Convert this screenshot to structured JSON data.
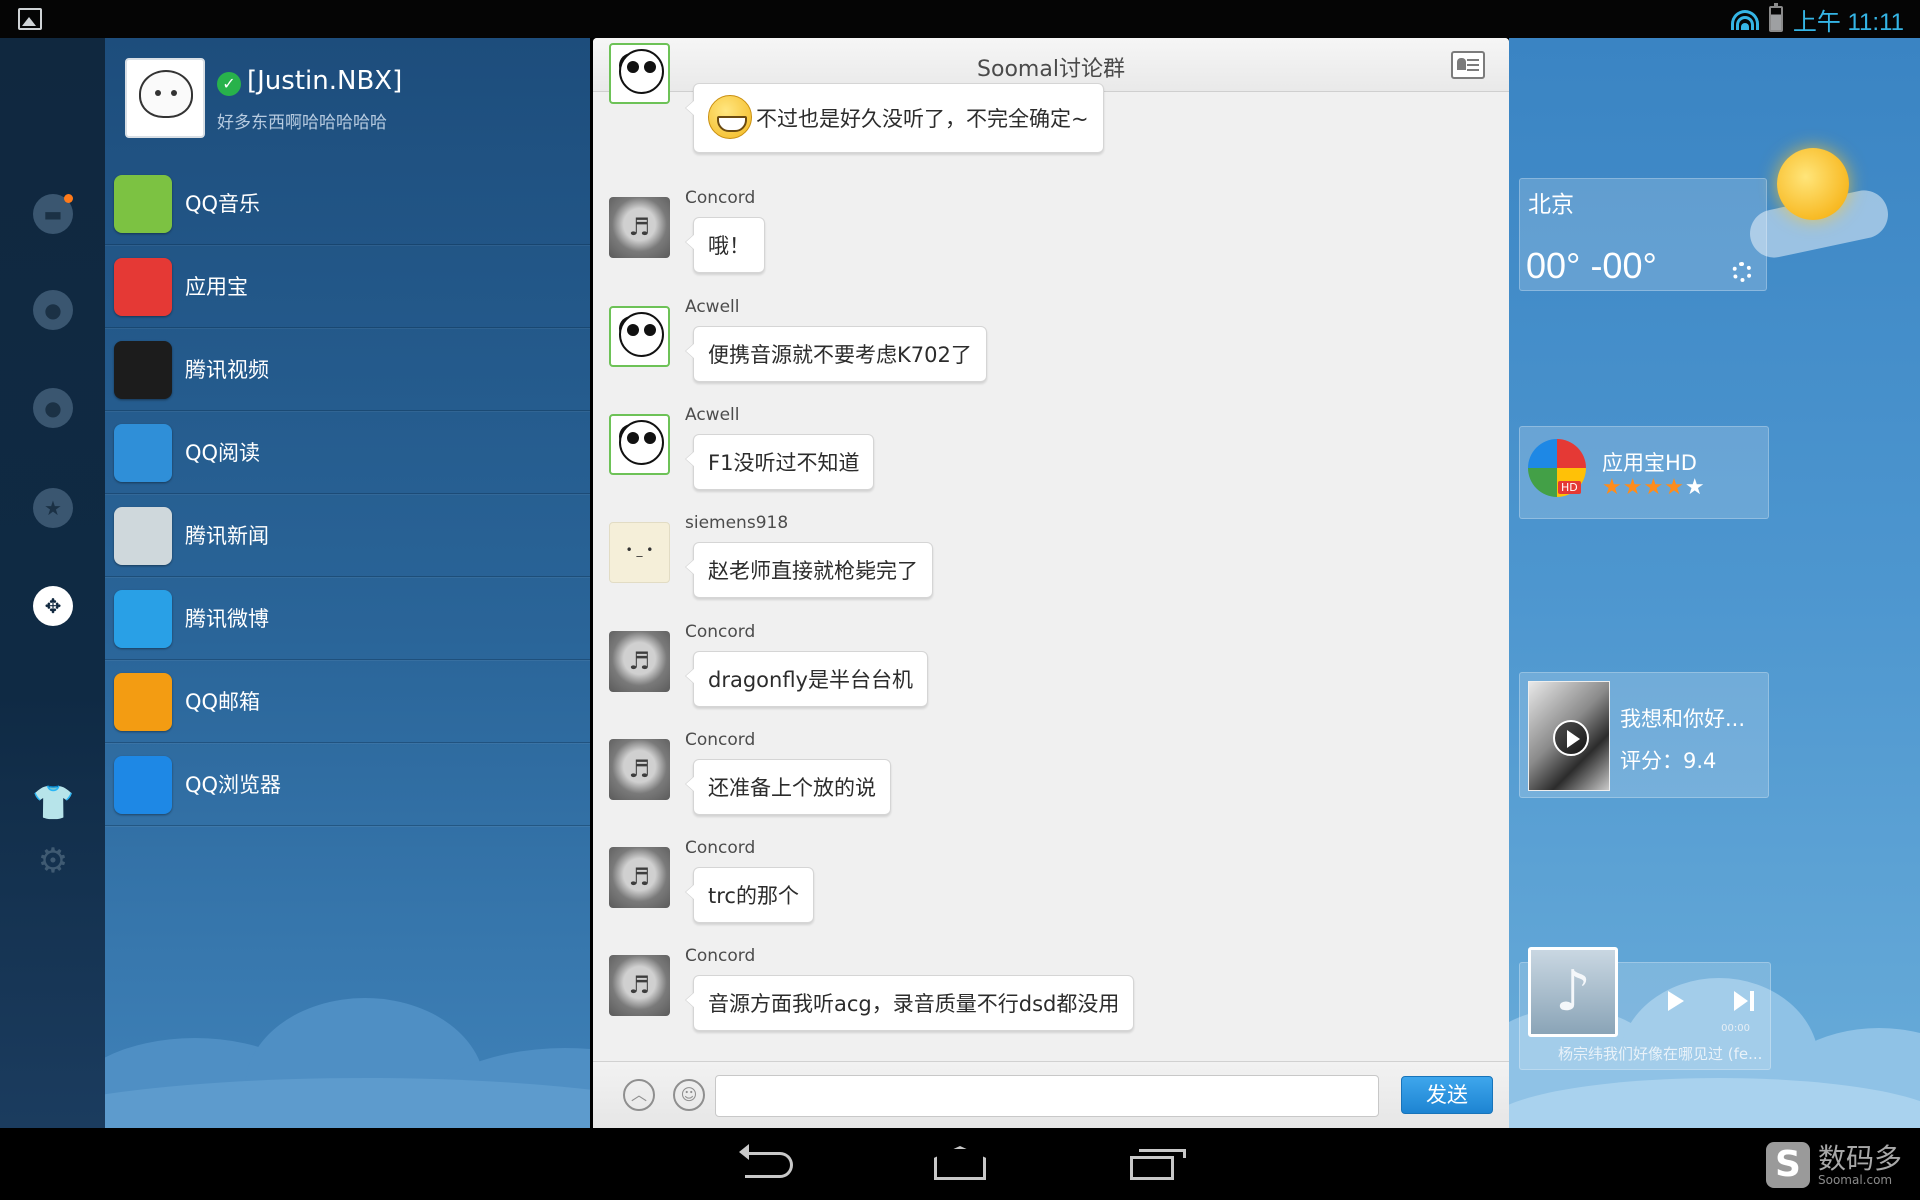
{
  "status_bar": {
    "time": "上午 11:11"
  },
  "profile": {
    "name": "[Justin.NBX]",
    "signature": "好多东西啊哈哈哈哈哈"
  },
  "apps": [
    {
      "label": "QQ音乐",
      "icon": "qq-music-icon",
      "color": "#7cc242"
    },
    {
      "label": "应用宝",
      "icon": "app-store-icon",
      "color": "#e53935"
    },
    {
      "label": "腾讯视频",
      "icon": "tencent-video-icon",
      "color": "#1c1c1c"
    },
    {
      "label": "QQ阅读",
      "icon": "qq-reader-icon",
      "color": "#2f8fd8"
    },
    {
      "label": "腾讯新闻",
      "icon": "tencent-news-icon",
      "color": "#cfd8dc"
    },
    {
      "label": "腾讯微博",
      "icon": "tencent-weibo-icon",
      "color": "#29a0e6"
    },
    {
      "label": "QQ邮箱",
      "icon": "qq-mail-icon",
      "color": "#f39c12"
    },
    {
      "label": "QQ浏览器",
      "icon": "qq-browser-icon",
      "color": "#1e88e5"
    }
  ],
  "chat": {
    "title": "Soomal讨论群",
    "messages": [
      {
        "sender": "",
        "text": "不过也是好久没听了，不完全确定~"
      },
      {
        "sender": "Concord",
        "text": "哦！"
      },
      {
        "sender": "Acwell",
        "text": "便携音源就不要考虑K702了"
      },
      {
        "sender": "Acwell",
        "text": "F1没听过不知道"
      },
      {
        "sender": "siemens918",
        "text": "赵老师直接就枪毙完了"
      },
      {
        "sender": "Concord",
        "text": "dragonfly是半台台机"
      },
      {
        "sender": "Concord",
        "text": "还准备上个放的说"
      },
      {
        "sender": "Concord",
        "text": "trc的那个"
      },
      {
        "sender": "Concord",
        "text": "音源方面我听acg，录音质量不行dsd都没用"
      }
    ],
    "input_value": "",
    "send_label": "发送"
  },
  "weather": {
    "city": "北京",
    "temperature": "00° -00°"
  },
  "app_widget": {
    "name": "应用宝HD",
    "hd_tag": "HD",
    "rating": 4.5
  },
  "video_widget": {
    "title": "我想和你好...",
    "score": "评分：9.4"
  },
  "music_widget": {
    "time": "00:00",
    "song": "杨宗纬我们好像在哪见过 (fe..."
  },
  "watermark": {
    "title": "数码多",
    "site": "Soomal.com"
  }
}
